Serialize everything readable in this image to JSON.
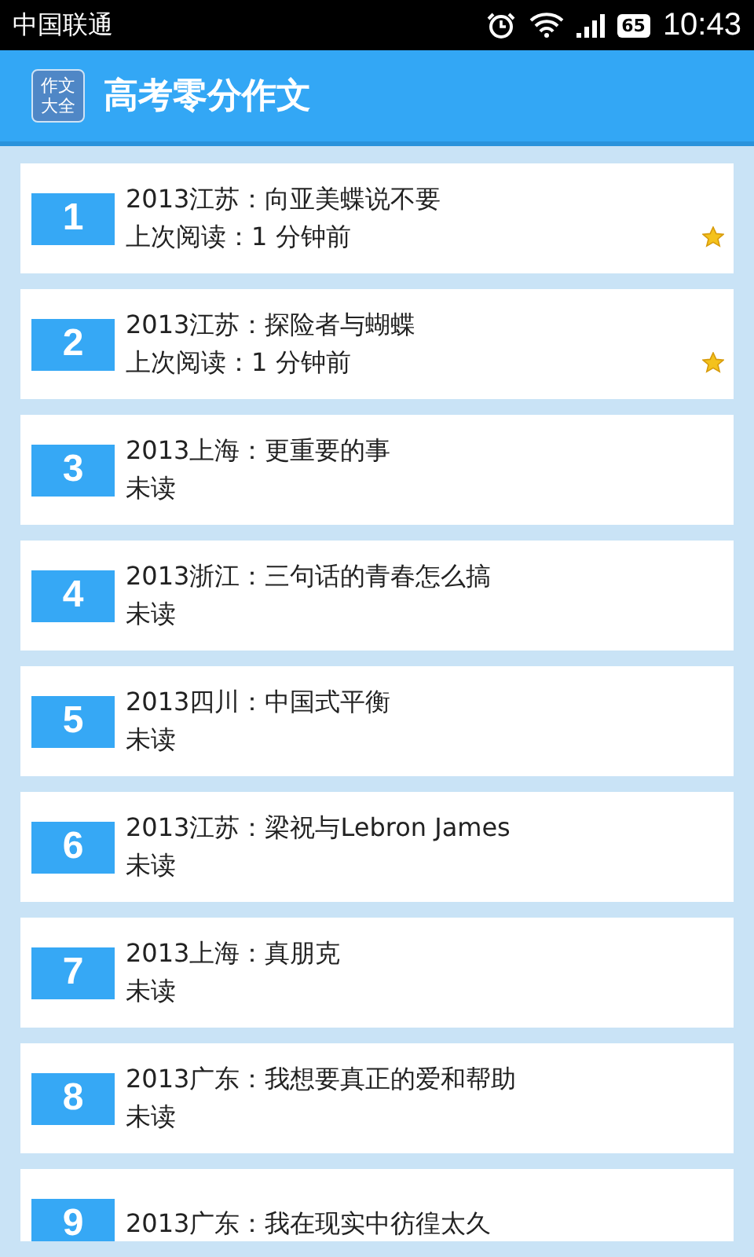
{
  "status_bar": {
    "carrier": "中国联通",
    "battery": "65",
    "time": "10:43"
  },
  "app_bar": {
    "logo": [
      "作文",
      "大全"
    ],
    "title": "高考零分作文"
  },
  "items": [
    {
      "number": "1",
      "title": "2013江苏：向亚美蝶说不要",
      "status": "上次阅读：1 分钟前",
      "starred": true
    },
    {
      "number": "2",
      "title": "2013江苏：探险者与蝴蝶",
      "status": "上次阅读：1 分钟前",
      "starred": true
    },
    {
      "number": "3",
      "title": "2013上海：更重要的事",
      "status": "未读",
      "starred": false
    },
    {
      "number": "4",
      "title": "2013浙江：三句话的青春怎么搞",
      "status": "未读",
      "starred": false
    },
    {
      "number": "5",
      "title": "2013四川：中国式平衡",
      "status": "未读",
      "starred": false
    },
    {
      "number": "6",
      "title": "2013江苏：梁祝与Lebron James",
      "status": "未读",
      "starred": false
    },
    {
      "number": "7",
      "title": "2013上海：真朋克",
      "status": "未读",
      "starred": false
    },
    {
      "number": "8",
      "title": "2013广东：我想要真正的爱和帮助",
      "status": "未读",
      "starred": false
    },
    {
      "number": "9",
      "title": "2013广东：我在现实中彷徨太久",
      "starred": false
    }
  ]
}
